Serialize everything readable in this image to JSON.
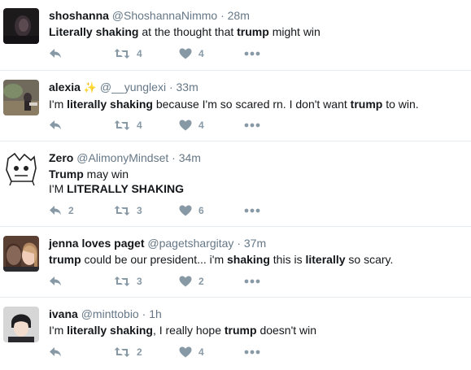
{
  "tweets": [
    {
      "name": "shoshanna",
      "handle": "@ShoshannaNimmo",
      "time": "28m",
      "sparkle": "",
      "segments": [
        {
          "t": "Literally shaking",
          "b": true
        },
        {
          "t": " at the thought that ",
          "b": false
        },
        {
          "t": "trump",
          "b": true
        },
        {
          "t": " might win",
          "b": false
        }
      ],
      "reply_count": "",
      "retweet_count": "4",
      "like_count": "4"
    },
    {
      "name": "alexia",
      "handle": "@__yunglexi",
      "time": "33m",
      "sparkle": "✨",
      "segments": [
        {
          "t": "I'm ",
          "b": false
        },
        {
          "t": "literally shaking",
          "b": true
        },
        {
          "t": " because I'm so scared rn. I don't want ",
          "b": false
        },
        {
          "t": "trump",
          "b": true
        },
        {
          "t": " to win.",
          "b": false
        }
      ],
      "reply_count": "",
      "retweet_count": "4",
      "like_count": "4"
    },
    {
      "name": "Zero",
      "handle": "@AlimonyMindset",
      "time": "34m",
      "sparkle": "",
      "segments": [
        {
          "t": "Trump",
          "b": true
        },
        {
          "t": " may win",
          "b": false
        },
        {
          "t": "\n",
          "b": false
        },
        {
          "t": "I'M ",
          "b": false
        },
        {
          "t": "LITERALLY SHAKING",
          "b": true
        }
      ],
      "reply_count": "2",
      "retweet_count": "3",
      "like_count": "6"
    },
    {
      "name": "jenna loves paget",
      "handle": "@pagetshargitay",
      "time": "37m",
      "sparkle": "",
      "segments": [
        {
          "t": "trump",
          "b": true
        },
        {
          "t": " could be our president... i'm ",
          "b": false
        },
        {
          "t": "shaking",
          "b": true
        },
        {
          "t": " this is ",
          "b": false
        },
        {
          "t": "literally",
          "b": true
        },
        {
          "t": " so scary.",
          "b": false
        }
      ],
      "reply_count": "",
      "retweet_count": "3",
      "like_count": "2"
    },
    {
      "name": "ivana",
      "handle": "@minttobio",
      "time": "1h",
      "sparkle": "",
      "segments": [
        {
          "t": "I'm ",
          "b": false
        },
        {
          "t": "literally shaking",
          "b": true
        },
        {
          "t": ", I really hope ",
          "b": false
        },
        {
          "t": "trump",
          "b": true
        },
        {
          "t": " doesn't win",
          "b": false
        }
      ],
      "reply_count": "",
      "retweet_count": "2",
      "like_count": "4"
    }
  ],
  "separator": "·",
  "colors": {
    "icon": "#8899a6",
    "handle": "#657786",
    "border": "#e6ecf0",
    "text": "#14171a"
  },
  "icons": [
    "reply-icon",
    "retweet-icon",
    "like-icon",
    "more-icon"
  ]
}
